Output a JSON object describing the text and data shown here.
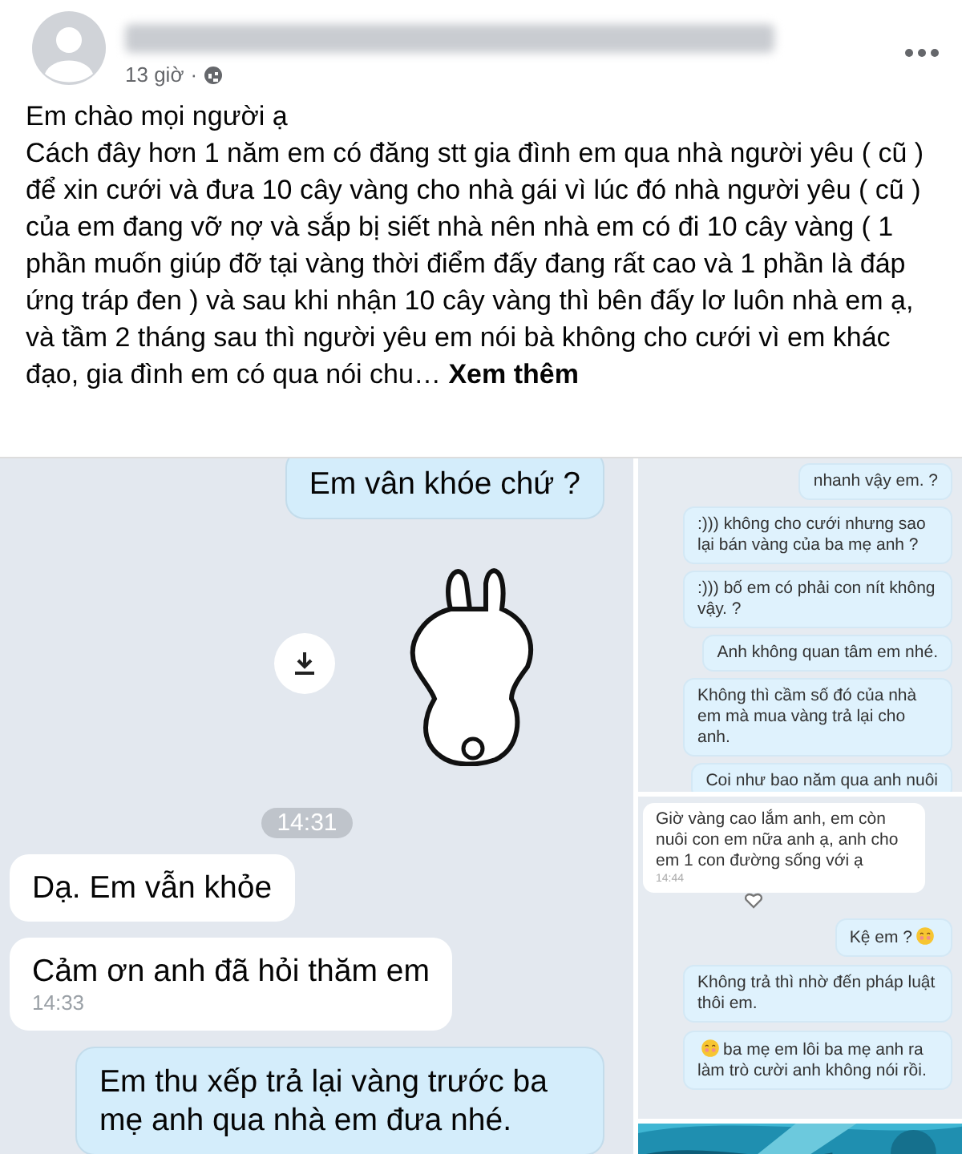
{
  "post": {
    "time": "13 giờ",
    "separator": "·",
    "greeting": "Em chào mọi người ạ",
    "body": "Cách đây hơn 1 năm em có đăng stt gia đình em qua nhà người yêu ( cũ ) để xin cưới và đưa 10 cây vàng cho nhà gái vì lúc đó nhà người yêu ( cũ ) của em đang vỡ nợ và sắp bị siết nhà nên nhà em có đi 10 cây vàng ( 1 phần muốn giúp đỡ tại vàng thời điểm đấy đang rất cao và 1 phần là đáp ứng tráp đen ) và sau khi nhận 10 cây vàng thì bên đấy lơ luôn nhà em ạ, và tầm 2 tháng sau thì người yêu em nói bà không cho cưới vì em khác đạo, gia đình em có qua nói chu…",
    "see_more": "Xem thêm"
  },
  "left_chat": {
    "messages": [
      {
        "kind": "sent",
        "text": "Em vân khóe chứ ?"
      },
      {
        "kind": "sticker"
      },
      {
        "kind": "time",
        "text": "14:31"
      },
      {
        "kind": "received",
        "text": "Dạ. Em vẫn khỏe"
      },
      {
        "kind": "received",
        "text": "Cảm ơn anh đã hỏi thăm em",
        "time": "14:33"
      },
      {
        "kind": "sent",
        "text": "Em thu xếp trả lại vàng trước ba mẹ anh qua nhà em đưa nhé."
      }
    ]
  },
  "right_chat_1": {
    "messages": [
      {
        "kind": "sent",
        "text": "nhanh vậy em. ?"
      },
      {
        "kind": "sent",
        "text": ":))) không cho cưới nhưng sao lại bán vàng của ba mẹ anh ?"
      },
      {
        "kind": "sent",
        "text": ":))) bố em có phải con nít không vậy. ?"
      },
      {
        "kind": "sent",
        "text": "Anh không quan tâm em nhé."
      },
      {
        "kind": "sent",
        "text": "Không thì cầm số đó của nhà em mà mua vàng trả lại cho anh."
      },
      {
        "kind": "sent",
        "text": "Coi như bao năm qua anh nuôi"
      }
    ]
  },
  "right_chat_2": {
    "messages": [
      {
        "kind": "received",
        "text": "Giờ vàng cao lắm anh, em còn nuôi con em nữa anh ạ,  anh cho em 1 con đường sống với ạ",
        "time": "14:44"
      },
      {
        "kind": "reaction"
      },
      {
        "kind": "sent",
        "text": "Kệ em ?",
        "emoji_after": true
      },
      {
        "kind": "sent",
        "text": "Không trả thì nhờ đến pháp luật thôi em."
      },
      {
        "kind": "sent",
        "text": "ba mẹ em lôi ba mẹ anh ra làm trò cười anh không nói rồi.",
        "emoji_before": true
      }
    ]
  }
}
